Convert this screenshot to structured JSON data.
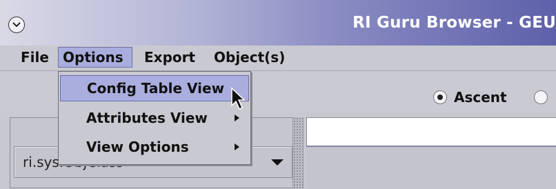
{
  "window": {
    "title": "RI Guru Browser - GEU",
    "system_menu_icon": "chevron-down-circle-icon",
    "title_gradient_end": "#5e60aa"
  },
  "menubar": {
    "items": [
      {
        "label": "File"
      },
      {
        "label": "Options",
        "active": true
      },
      {
        "label": "Export"
      },
      {
        "label": "Object(s)"
      }
    ]
  },
  "options_menu": {
    "items": [
      {
        "label": "Config Table View",
        "highlighted": true,
        "has_submenu": false
      },
      {
        "label": "Attributes View",
        "has_submenu": true
      },
      {
        "label": "View Options",
        "has_submenu": true
      }
    ]
  },
  "direction": {
    "selected": "Ascent",
    "options": [
      {
        "label": "Ascent",
        "checked": true
      },
      {
        "label": "",
        "checked": false
      }
    ]
  },
  "object_combo": {
    "value": "ri.sys.ObjClass"
  },
  "right_input": {
    "value": ""
  },
  "colors": {
    "menu_highlight": "#a9aede",
    "background": "#c8c8d0"
  }
}
